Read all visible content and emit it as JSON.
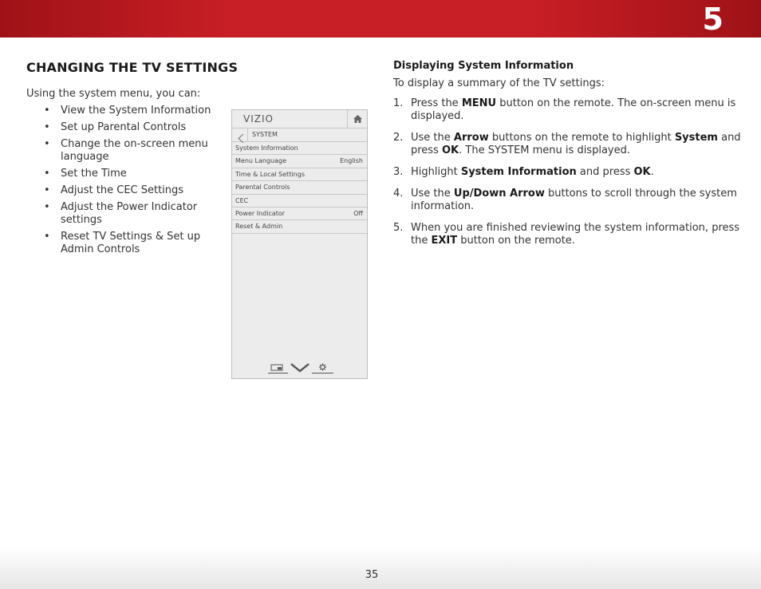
{
  "chapter_number": "5",
  "page_number": "35",
  "left": {
    "heading": "CHANGING THE TV SETTINGS",
    "intro": "Using the system menu, you can:",
    "bullet_char": "•",
    "bullets": [
      "View the System Information",
      "Set up Parental Controls",
      "Change the on-screen menu language",
      "Set the Time",
      "Adjust the CEC Settings",
      "Adjust the Power Indicator settings",
      "Reset TV Settings & Set up Admin Controls"
    ]
  },
  "tv_menu": {
    "logo": "VIZIO",
    "home_icon": "home-icon",
    "back_icon": "chevron-left-icon",
    "submenu_title": "SYSTEM",
    "rows": [
      {
        "label": "System Information",
        "value": ""
      },
      {
        "label": "Menu Language",
        "value": "English"
      },
      {
        "label": "Time & Local Settings",
        "value": ""
      },
      {
        "label": "Parental Controls",
        "value": ""
      },
      {
        "label": "CEC",
        "value": ""
      },
      {
        "label": "Power Indicator",
        "value": "Off"
      },
      {
        "label": "Reset & Admin",
        "value": ""
      }
    ],
    "footer_icons": [
      "wide-screen-icon",
      "vizio-v-icon",
      "gear-icon"
    ]
  },
  "right": {
    "heading": "Displaying System Information",
    "intro": "To display a summary of the TV settings:",
    "steps": [
      {
        "num": "1.",
        "parts": [
          "Press the ",
          {
            "b": "MENU"
          },
          " button on the remote. The on-screen menu is displayed."
        ]
      },
      {
        "num": "2.",
        "parts": [
          "Use the ",
          {
            "b": "Arrow"
          },
          " buttons on the remote to highlight ",
          {
            "b": "System"
          },
          " and press ",
          {
            "b": "OK"
          },
          ". The SYSTEM menu is displayed."
        ]
      },
      {
        "num": "3.",
        "parts": [
          "Highlight ",
          {
            "b": "System Information"
          },
          " and press ",
          {
            "b": "OK"
          },
          "."
        ]
      },
      {
        "num": "4.",
        "parts": [
          "Use the ",
          {
            "b": "Up/Down Arrow"
          },
          " buttons to scroll through the system information."
        ]
      },
      {
        "num": "5.",
        "parts": [
          "When you are finished reviewing the system information, press the ",
          {
            "b": "EXIT"
          },
          " button on the remote."
        ]
      }
    ]
  },
  "colors": {
    "header_red": "#c81e25",
    "header_red_dark": "#9e1217"
  }
}
